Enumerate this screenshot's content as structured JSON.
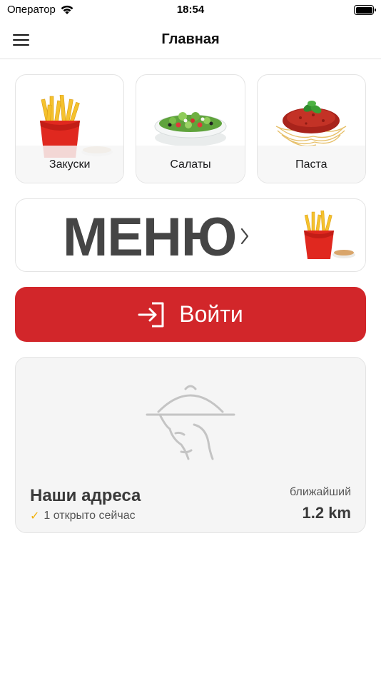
{
  "status_bar": {
    "carrier": "Оператор",
    "time": "18:54"
  },
  "nav": {
    "title": "Главная"
  },
  "categories": [
    {
      "label": "Закуски",
      "icon": "fries-icon"
    },
    {
      "label": "Салаты",
      "icon": "salad-icon"
    },
    {
      "label": "Паста",
      "icon": "pasta-icon"
    }
  ],
  "menu_banner": {
    "title": "МЕНЮ"
  },
  "login_button": {
    "label": "Войти",
    "icon": "login-arrow-icon"
  },
  "addresses": {
    "title": "Наши адреса",
    "status": "1 открыто сейчас",
    "nearest_label": "ближайший",
    "nearest_distance": "1.2 km"
  },
  "colors": {
    "accent": "#d2262a",
    "check": "#f2b10c",
    "card_border": "#e4e4e4",
    "menu_text": "#454545"
  }
}
